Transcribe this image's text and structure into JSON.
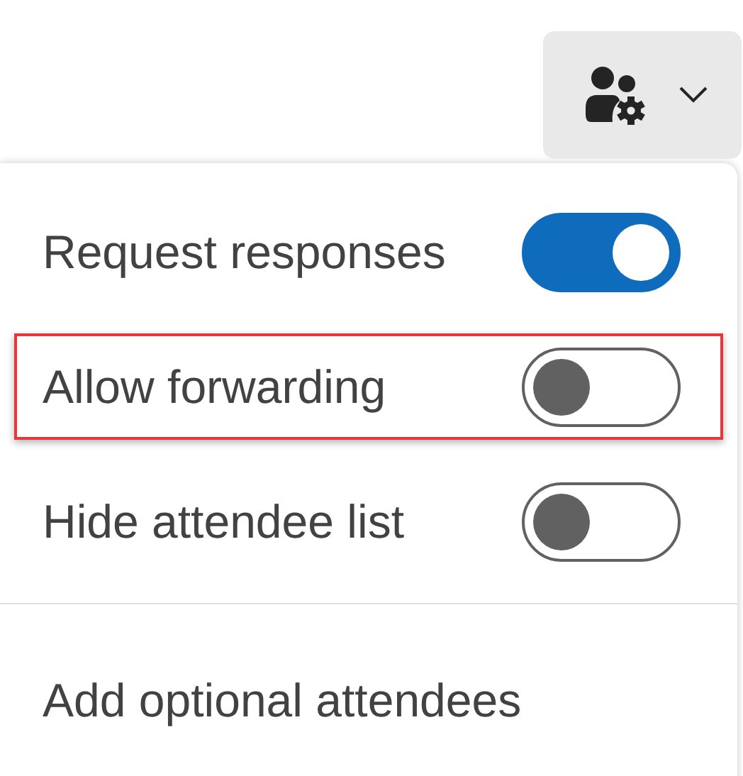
{
  "options": [
    {
      "kind": "toggle",
      "label": "Request responses",
      "on": true,
      "highlighted": false
    },
    {
      "kind": "toggle",
      "label": "Allow forwarding",
      "on": false,
      "highlighted": true
    },
    {
      "kind": "toggle",
      "label": "Hide attendee list",
      "on": false,
      "highlighted": false
    },
    {
      "kind": "divider"
    },
    {
      "kind": "action",
      "label": "Add optional attendees"
    }
  ]
}
